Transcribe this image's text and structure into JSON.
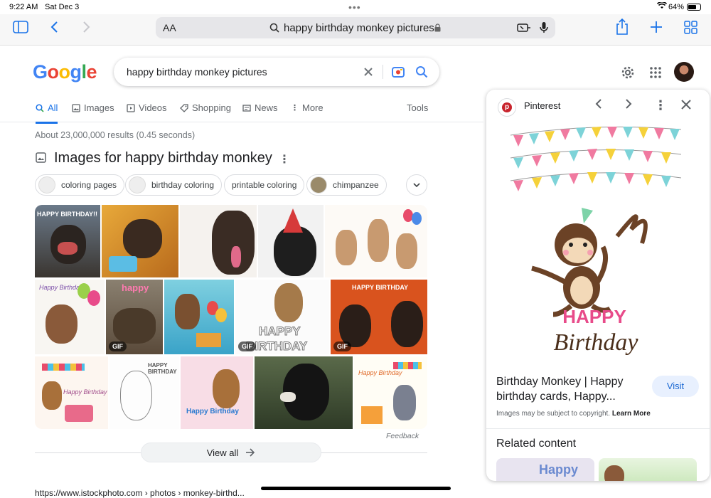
{
  "status_bar": {
    "time": "9:22 AM",
    "date": "Sat Dec 3",
    "battery": "64%"
  },
  "browser": {
    "text_size_label": "AA",
    "address": "happy birthday monkey pictures"
  },
  "google": {
    "logo_letters": [
      "G",
      "o",
      "o",
      "g",
      "l",
      "e"
    ],
    "search_query": "happy birthday monkey pictures",
    "tabs": [
      "All",
      "Images",
      "Videos",
      "Shopping",
      "News",
      "More"
    ],
    "tools_label": "Tools",
    "results_info": "About 23,000,000 results (0.45 seconds)",
    "images_heading": "Images for happy birthday monkey",
    "chips": [
      "coloring pages",
      "birthday coloring",
      "printable coloring",
      "chimpanzee"
    ],
    "gif_badge": "GIF",
    "tile_texts": {
      "t1": "HAPPY BIRTHDAY!!",
      "t7": "Happy Birthday!",
      "t8": "happy",
      "t10": "HAPPY",
      "t10b": "BIRTHDAY",
      "t11": "HAPPY BIRTHDAY",
      "t13": "Happy Birthday",
      "t14": "HAPPY BIRTHDAY",
      "t17": "Happy Birthday"
    },
    "feedback": "Feedback",
    "view_all": "View all",
    "bottom_link": "https://www.istockphoto.com › photos › monkey-birthd..."
  },
  "preview": {
    "source": "Pinterest",
    "title": "Birthday Monkey | Happy birthday cards, Happy...",
    "visit": "Visit",
    "copyright": "Images may be subject to copyright.",
    "learn_more": "Learn More",
    "related_heading": "Related content",
    "image_text_happy": "HAPPY",
    "image_text_birthday": "Birthday",
    "related_thumb_text": "Happy"
  },
  "colors": {
    "google_blue": "#4285F4",
    "google_red": "#EA4335",
    "google_yellow": "#FBBC05",
    "google_green": "#34A853",
    "accent": "#1a73e8"
  }
}
